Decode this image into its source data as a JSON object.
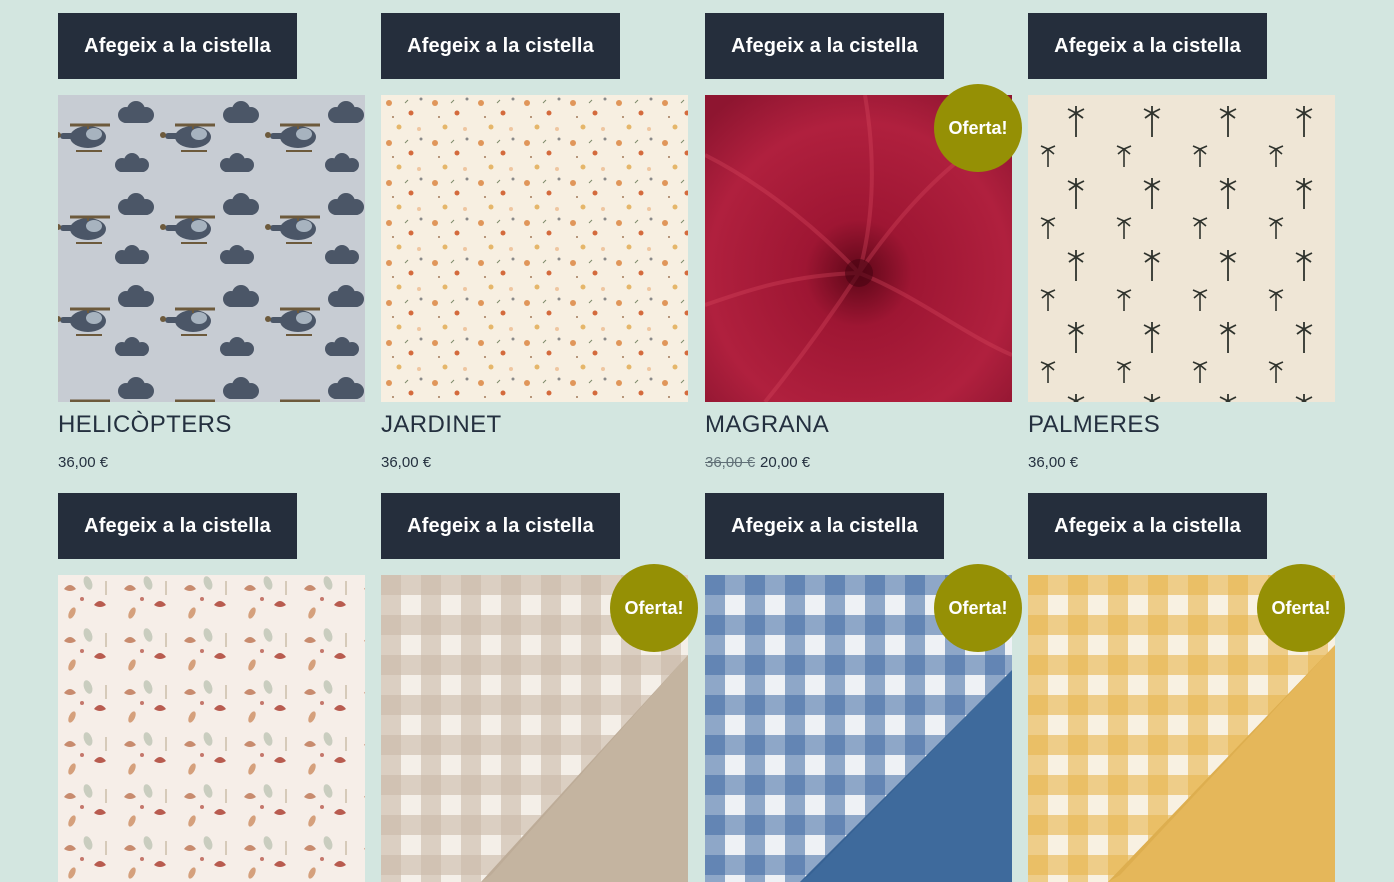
{
  "products": [
    {
      "button_label": "Afegeix a la cistella",
      "name": "HELICÒPTERS",
      "price": "36,00 €",
      "image_icon": "helicopter-fabric-image"
    },
    {
      "button_label": "Afegeix a la cistella",
      "name": "JARDINET",
      "price": "36,00 €",
      "image_icon": "floral-fabric-image"
    },
    {
      "button_label": "Afegeix a la cistella",
      "name": "MAGRANA",
      "old_price": "36,00 €",
      "price": "20,00 €",
      "badge": "Oferta!",
      "image_icon": "red-fabric-image"
    },
    {
      "button_label": "Afegeix a la cistella",
      "name": "PALMERES",
      "price": "36,00 €",
      "image_icon": "palm-fabric-image"
    },
    {
      "button_label": "Afegeix a la cistella",
      "image_icon": "birds-floral-fabric-image"
    },
    {
      "button_label": "Afegeix a la cistella",
      "badge": "Oferta!",
      "image_icon": "beige-gingham-fabric-image"
    },
    {
      "button_label": "Afegeix a la cistella",
      "badge": "Oferta!",
      "image_icon": "blue-gingham-fabric-image"
    },
    {
      "button_label": "Afegeix a la cistella",
      "badge": "Oferta!",
      "image_icon": "yellow-gingham-fabric-image"
    }
  ],
  "colors": {
    "background": "#d3e6e0",
    "button": "#252e3c",
    "badge": "#959005",
    "text": "#24303f"
  }
}
